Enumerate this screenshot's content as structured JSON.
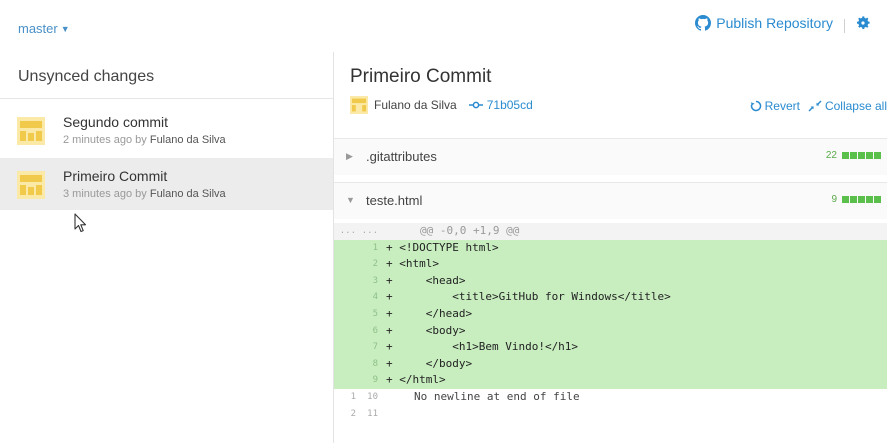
{
  "topbar": {
    "branch": "master",
    "caret": "▼",
    "publish_label": "Publish Repository"
  },
  "left": {
    "heading": "Unsynced changes",
    "commits": [
      {
        "title": "Segundo commit",
        "time": "2 minutes ago by ",
        "author": "Fulano da Silva"
      },
      {
        "title": "Primeiro Commit",
        "time": "3 minutes ago by ",
        "author": "Fulano da Silva"
      }
    ]
  },
  "commit": {
    "title": "Primeiro Commit",
    "author": "Fulano da Silva",
    "sha": "71b05cd",
    "revert_label": "Revert",
    "collapse_label": "Collapse all"
  },
  "files": [
    {
      "name": ".gitattributes",
      "count": "22",
      "expanded": false
    },
    {
      "name": "teste.html",
      "count": "9",
      "expanded": true
    }
  ],
  "diff": {
    "hunk_nums": [
      "...",
      "..."
    ],
    "hunk": "@@ -0,0 +1,9 @@",
    "lines": [
      {
        "n1": "",
        "n2": "1",
        "text": "+ <!DOCTYPE html>"
      },
      {
        "n1": "",
        "n2": "2",
        "text": "+ <html>"
      },
      {
        "n1": "",
        "n2": "3",
        "text": "+     <head>"
      },
      {
        "n1": "",
        "n2": "4",
        "text": "+         <title>GitHub for Windows</title>"
      },
      {
        "n1": "",
        "n2": "5",
        "text": "+     </head>"
      },
      {
        "n1": "",
        "n2": "6",
        "text": "+     <body>"
      },
      {
        "n1": "",
        "n2": "7",
        "text": "+         <h1>Bem Vindo!</h1>"
      },
      {
        "n1": "",
        "n2": "8",
        "text": "+     </body>"
      },
      {
        "n1": "",
        "n2": "9",
        "text": "+ </html>"
      }
    ],
    "ctx": [
      {
        "n1": "1",
        "n2": "10",
        "text": "No newline at end of file"
      },
      {
        "n1": "2",
        "n2": "11",
        "text": ""
      }
    ]
  },
  "colors": {
    "accent": "#2a8bd0",
    "add_bg": "#c8eec0",
    "bar_green": "#5bbf4c"
  }
}
